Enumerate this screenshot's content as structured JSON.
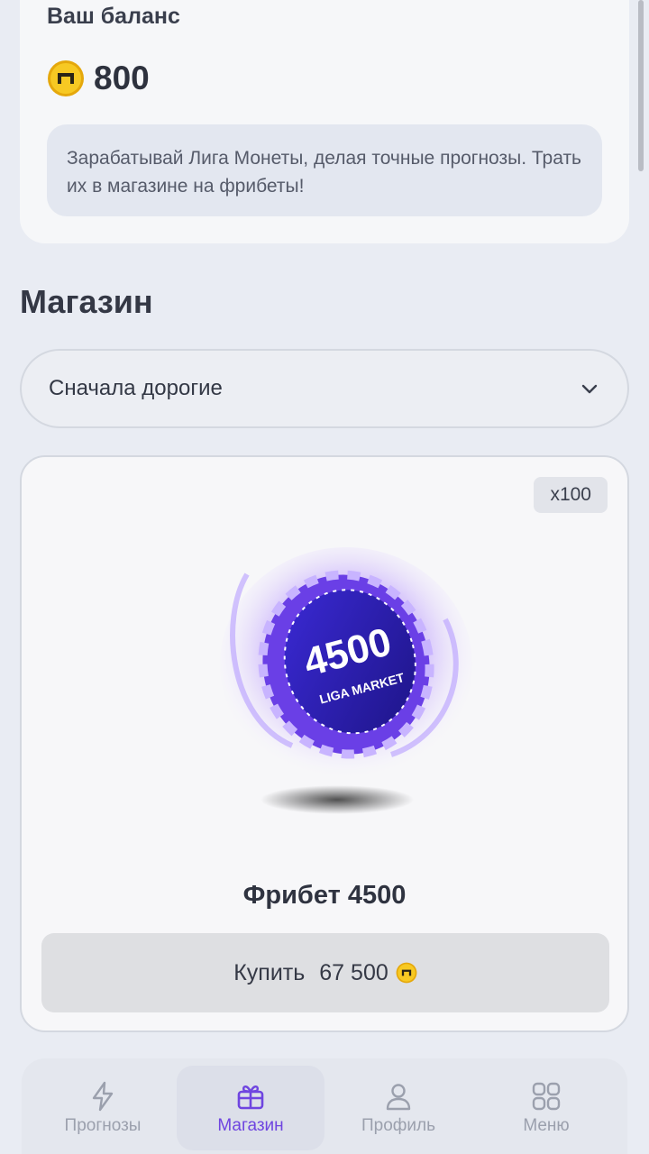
{
  "balance": {
    "title": "Ваш баланс",
    "value": "800",
    "info": "Зарабатывай Лига Монеты, делая точные прогнозы. Трать их в магазине на фрибеты!"
  },
  "shop": {
    "title": "Магазин",
    "sort": {
      "selected": "Сначала дорогие"
    },
    "products": [
      {
        "quantity_badge": "x100",
        "chip_value": "4500",
        "chip_brand": "LIGA MARKET",
        "name": "Фрибет 4500",
        "buy_label": "Купить",
        "price": "67 500"
      }
    ]
  },
  "nav": {
    "items": [
      {
        "label": "Прогнозы",
        "icon": "lightning-icon",
        "active": false
      },
      {
        "label": "Магазин",
        "icon": "gift-icon",
        "active": true
      },
      {
        "label": "Профиль",
        "icon": "user-icon",
        "active": false
      },
      {
        "label": "Меню",
        "icon": "grid-icon",
        "active": false
      }
    ]
  },
  "colors": {
    "accent": "#6f45e0",
    "coin": "#f2c21a",
    "background": "#e9ecf3"
  }
}
